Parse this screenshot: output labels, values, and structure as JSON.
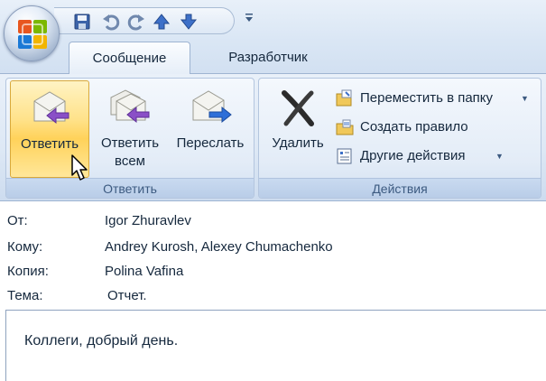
{
  "ribbon": {
    "tabs": [
      {
        "label": "Сообщение",
        "active": true
      },
      {
        "label": "Разработчик",
        "active": false
      }
    ],
    "groups": {
      "reply": {
        "label": "Ответить",
        "buttons": {
          "reply": "Ответить",
          "reply_all_line1": "Ответить",
          "reply_all_line2": "всем",
          "forward": "Переслать"
        }
      },
      "actions": {
        "label": "Действия",
        "delete": "Удалить",
        "move_to_folder": "Переместить в папку",
        "create_rule": "Создать правило",
        "other_actions": "Другие действия"
      }
    }
  },
  "quick_access": {
    "icons": [
      "save-icon",
      "undo-icon",
      "redo-icon",
      "previous-item-icon",
      "next-item-icon",
      "customize-qat-icon"
    ]
  },
  "header": {
    "from": {
      "label": "От:",
      "value": "Igor Zhuravlev"
    },
    "to": {
      "label": "Кому:",
      "value": "Andrey Kurosh, Alexey Chumachenko"
    },
    "cc": {
      "label": "Копия:",
      "value": "Polina Vafina"
    },
    "subject": {
      "label": "Тема:",
      "value": "Отчет."
    }
  },
  "body": {
    "text": "Коллеги, добрый день."
  },
  "colors": {
    "ribbon_bg": "#dde8f5",
    "hover_button": "#ffd25a",
    "group_label": "#3c5a80",
    "arrow_purple": "#8a4fc7",
    "arrow_blue": "#2e6fd8"
  }
}
